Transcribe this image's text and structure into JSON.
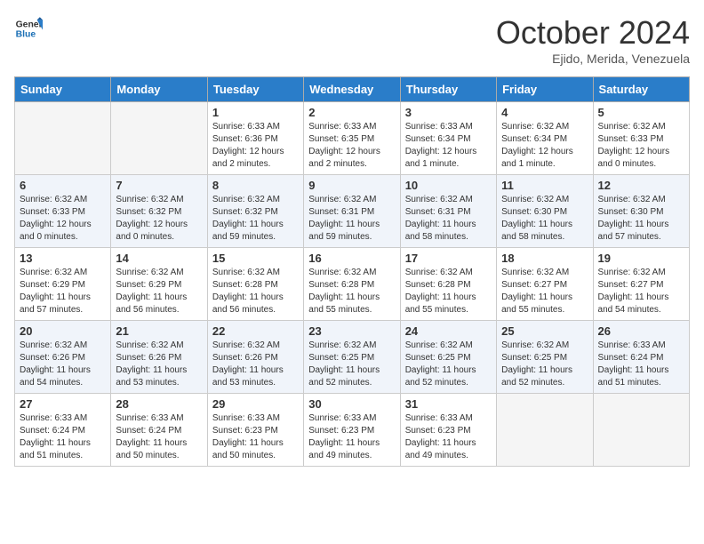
{
  "header": {
    "logo_general": "General",
    "logo_blue": "Blue",
    "month": "October 2024",
    "location": "Ejido, Merida, Venezuela"
  },
  "columns": [
    "Sunday",
    "Monday",
    "Tuesday",
    "Wednesday",
    "Thursday",
    "Friday",
    "Saturday"
  ],
  "weeks": [
    [
      {
        "day": "",
        "info": "",
        "empty": true
      },
      {
        "day": "",
        "info": "",
        "empty": true
      },
      {
        "day": "1",
        "info": "Sunrise: 6:33 AM\nSunset: 6:36 PM\nDaylight: 12 hours\nand 2 minutes.",
        "empty": false
      },
      {
        "day": "2",
        "info": "Sunrise: 6:33 AM\nSunset: 6:35 PM\nDaylight: 12 hours\nand 2 minutes.",
        "empty": false
      },
      {
        "day": "3",
        "info": "Sunrise: 6:33 AM\nSunset: 6:34 PM\nDaylight: 12 hours\nand 1 minute.",
        "empty": false
      },
      {
        "day": "4",
        "info": "Sunrise: 6:32 AM\nSunset: 6:34 PM\nDaylight: 12 hours\nand 1 minute.",
        "empty": false
      },
      {
        "day": "5",
        "info": "Sunrise: 6:32 AM\nSunset: 6:33 PM\nDaylight: 12 hours\nand 0 minutes.",
        "empty": false
      }
    ],
    [
      {
        "day": "6",
        "info": "Sunrise: 6:32 AM\nSunset: 6:33 PM\nDaylight: 12 hours\nand 0 minutes.",
        "empty": false
      },
      {
        "day": "7",
        "info": "Sunrise: 6:32 AM\nSunset: 6:32 PM\nDaylight: 12 hours\nand 0 minutes.",
        "empty": false
      },
      {
        "day": "8",
        "info": "Sunrise: 6:32 AM\nSunset: 6:32 PM\nDaylight: 11 hours\nand 59 minutes.",
        "empty": false
      },
      {
        "day": "9",
        "info": "Sunrise: 6:32 AM\nSunset: 6:31 PM\nDaylight: 11 hours\nand 59 minutes.",
        "empty": false
      },
      {
        "day": "10",
        "info": "Sunrise: 6:32 AM\nSunset: 6:31 PM\nDaylight: 11 hours\nand 58 minutes.",
        "empty": false
      },
      {
        "day": "11",
        "info": "Sunrise: 6:32 AM\nSunset: 6:30 PM\nDaylight: 11 hours\nand 58 minutes.",
        "empty": false
      },
      {
        "day": "12",
        "info": "Sunrise: 6:32 AM\nSunset: 6:30 PM\nDaylight: 11 hours\nand 57 minutes.",
        "empty": false
      }
    ],
    [
      {
        "day": "13",
        "info": "Sunrise: 6:32 AM\nSunset: 6:29 PM\nDaylight: 11 hours\nand 57 minutes.",
        "empty": false
      },
      {
        "day": "14",
        "info": "Sunrise: 6:32 AM\nSunset: 6:29 PM\nDaylight: 11 hours\nand 56 minutes.",
        "empty": false
      },
      {
        "day": "15",
        "info": "Sunrise: 6:32 AM\nSunset: 6:28 PM\nDaylight: 11 hours\nand 56 minutes.",
        "empty": false
      },
      {
        "day": "16",
        "info": "Sunrise: 6:32 AM\nSunset: 6:28 PM\nDaylight: 11 hours\nand 55 minutes.",
        "empty": false
      },
      {
        "day": "17",
        "info": "Sunrise: 6:32 AM\nSunset: 6:28 PM\nDaylight: 11 hours\nand 55 minutes.",
        "empty": false
      },
      {
        "day": "18",
        "info": "Sunrise: 6:32 AM\nSunset: 6:27 PM\nDaylight: 11 hours\nand 55 minutes.",
        "empty": false
      },
      {
        "day": "19",
        "info": "Sunrise: 6:32 AM\nSunset: 6:27 PM\nDaylight: 11 hours\nand 54 minutes.",
        "empty": false
      }
    ],
    [
      {
        "day": "20",
        "info": "Sunrise: 6:32 AM\nSunset: 6:26 PM\nDaylight: 11 hours\nand 54 minutes.",
        "empty": false
      },
      {
        "day": "21",
        "info": "Sunrise: 6:32 AM\nSunset: 6:26 PM\nDaylight: 11 hours\nand 53 minutes.",
        "empty": false
      },
      {
        "day": "22",
        "info": "Sunrise: 6:32 AM\nSunset: 6:26 PM\nDaylight: 11 hours\nand 53 minutes.",
        "empty": false
      },
      {
        "day": "23",
        "info": "Sunrise: 6:32 AM\nSunset: 6:25 PM\nDaylight: 11 hours\nand 52 minutes.",
        "empty": false
      },
      {
        "day": "24",
        "info": "Sunrise: 6:32 AM\nSunset: 6:25 PM\nDaylight: 11 hours\nand 52 minutes.",
        "empty": false
      },
      {
        "day": "25",
        "info": "Sunrise: 6:32 AM\nSunset: 6:25 PM\nDaylight: 11 hours\nand 52 minutes.",
        "empty": false
      },
      {
        "day": "26",
        "info": "Sunrise: 6:33 AM\nSunset: 6:24 PM\nDaylight: 11 hours\nand 51 minutes.",
        "empty": false
      }
    ],
    [
      {
        "day": "27",
        "info": "Sunrise: 6:33 AM\nSunset: 6:24 PM\nDaylight: 11 hours\nand 51 minutes.",
        "empty": false
      },
      {
        "day": "28",
        "info": "Sunrise: 6:33 AM\nSunset: 6:24 PM\nDaylight: 11 hours\nand 50 minutes.",
        "empty": false
      },
      {
        "day": "29",
        "info": "Sunrise: 6:33 AM\nSunset: 6:23 PM\nDaylight: 11 hours\nand 50 minutes.",
        "empty": false
      },
      {
        "day": "30",
        "info": "Sunrise: 6:33 AM\nSunset: 6:23 PM\nDaylight: 11 hours\nand 49 minutes.",
        "empty": false
      },
      {
        "day": "31",
        "info": "Sunrise: 6:33 AM\nSunset: 6:23 PM\nDaylight: 11 hours\nand 49 minutes.",
        "empty": false
      },
      {
        "day": "",
        "info": "",
        "empty": true
      },
      {
        "day": "",
        "info": "",
        "empty": true
      }
    ]
  ]
}
